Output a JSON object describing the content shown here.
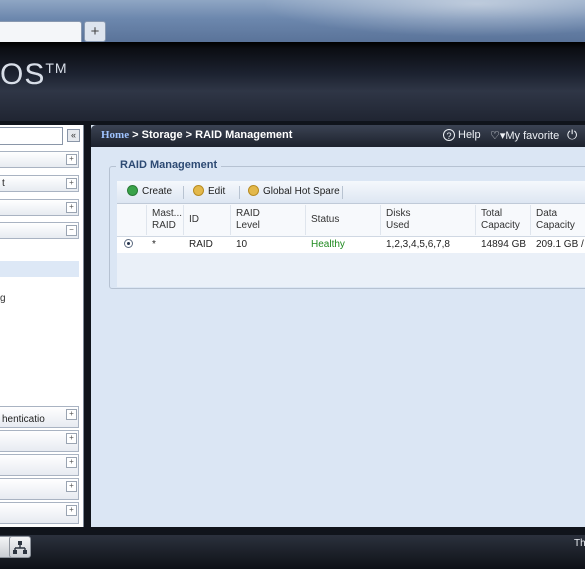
{
  "browser": {
    "tab_title": "",
    "new_tab_glyph": "+"
  },
  "app": {
    "logo_text": "OS",
    "logo_tm": "TM"
  },
  "breadcrumb": {
    "home": "Home",
    "sep1": " > ",
    "section": "Storage",
    "sep2": " > ",
    "page": "RAID Management"
  },
  "topbar": {
    "help_label": "Help",
    "favorite_label": "My favorite",
    "power_icon": "power-icon"
  },
  "sidebar": {
    "collapse_glyph": "«",
    "accordion": [
      {
        "label": "",
        "toggle": "+"
      },
      {
        "label": "t",
        "toggle": "+"
      },
      {
        "label": "",
        "toggle": "+"
      },
      {
        "label": "",
        "toggle": "−"
      }
    ],
    "selected_fragment": "",
    "item_fragment": "g",
    "accordion_bottom": [
      {
        "label": "henticatio",
        "toggle": "+"
      },
      {
        "label": "",
        "toggle": "+"
      },
      {
        "label": "",
        "toggle": "+"
      },
      {
        "label": "",
        "toggle": "+"
      },
      {
        "label": "",
        "toggle": "+"
      }
    ]
  },
  "panel": {
    "legend": "RAID Management",
    "toolbar": {
      "create": "Create",
      "edit": "Edit",
      "hot_spare": "Global Hot Spare"
    }
  },
  "grid": {
    "headers": [
      {
        "l1": "Mast...",
        "l2": "RAID"
      },
      {
        "l1": "ID",
        "l2": ""
      },
      {
        "l1": "RAID",
        "l2": "Level"
      },
      {
        "l1": "Status",
        "l2": ""
      },
      {
        "l1": "Disks",
        "l2": "Used"
      },
      {
        "l1": "Total",
        "l2": "Capacity"
      },
      {
        "l1": "Data",
        "l2": "Capacity"
      }
    ],
    "rows": [
      {
        "master": "*",
        "id": "RAID",
        "level": "10",
        "status": "Healthy",
        "disks": "1,2,3,4,5,6,7,8",
        "total": "14894 GB",
        "data": "209.1 GB /"
      }
    ],
    "status_color": "#1f8a1f"
  },
  "footer": {
    "text": "Th"
  },
  "colors": {
    "accent": "#2d4a73",
    "panel_bg": "#dbe6f4",
    "header_bg": "#1c2230"
  }
}
